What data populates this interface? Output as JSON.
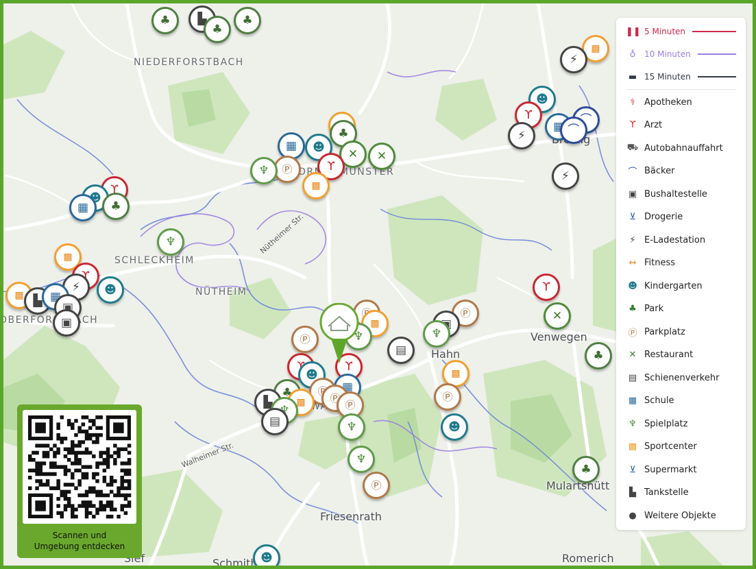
{
  "places": {
    "niederforstbach": "NIEDERFORSTBACH",
    "kornelimuenster": "KORNELIMÜNSTER",
    "schleckheim": "SCHLECKHEIM",
    "nuetheim": "NÜTHEIM",
    "oberforstbach": "OBERFORSTBACH",
    "walheim": "WALHEIM",
    "breinig": "Breinig",
    "hahn": "Hahn",
    "venwegen": "Venwegen",
    "mulartshuette": "Mulartshütt",
    "friesenrath": "Friesenrath",
    "schmithof": "Schmithof",
    "romerich": "Romerich",
    "sief": "Sief"
  },
  "streets": {
    "nuetheimer": "Nütheimer Str.",
    "walheimer": "Walheimer Str."
  },
  "legend": {
    "isochrones": [
      {
        "label": "5 Minuten",
        "icon": "footprints-icon",
        "color": "#d0284b"
      },
      {
        "label": "10 Minuten",
        "icon": "bicycle-icon",
        "color": "#9b7fe0"
      },
      {
        "label": "15 Minuten",
        "icon": "car-icon",
        "color": "#333a44"
      }
    ],
    "categories": [
      {
        "label": "Apotheken",
        "icon": "pharmacy-icon",
        "glyph": "⚕",
        "color": "#d32f2f"
      },
      {
        "label": "Arzt",
        "icon": "stethoscope-icon",
        "glyph": "ϒ",
        "color": "#d32f2f"
      },
      {
        "label": "Autobahnauffahrt",
        "icon": "highway-icon",
        "glyph": "⛟",
        "color": "#555555"
      },
      {
        "label": "Bäcker",
        "icon": "bread-icon",
        "glyph": "⌒",
        "color": "#2b4b9a"
      },
      {
        "label": "Bushaltestelle",
        "icon": "bus-icon",
        "glyph": "▣",
        "color": "#444444"
      },
      {
        "label": "Drogerie",
        "icon": "cart-icon",
        "glyph": "⊻",
        "color": "#1e5aa8"
      },
      {
        "label": "E-Ladestation",
        "icon": "ev-charger-icon",
        "glyph": "⚡",
        "color": "#444444"
      },
      {
        "label": "Fitness",
        "icon": "dumbbell-icon",
        "glyph": "↔",
        "color": "#f08a1a"
      },
      {
        "label": "Kindergarten",
        "icon": "kindergarten-icon",
        "glyph": "☻",
        "color": "#1f7a8c"
      },
      {
        "label": "Park",
        "icon": "tree-icon",
        "glyph": "♣",
        "color": "#2e7d32"
      },
      {
        "label": "Parkplatz",
        "icon": "parking-icon",
        "glyph": "Ⓟ",
        "color": "#b07a4a"
      },
      {
        "label": "Restaurant",
        "icon": "cutlery-icon",
        "glyph": "✕",
        "color": "#3e7a2a"
      },
      {
        "label": "Schienenverkehr",
        "icon": "train-icon",
        "glyph": "▤",
        "color": "#444444"
      },
      {
        "label": "Schule",
        "icon": "school-icon",
        "glyph": "▦",
        "color": "#2a6a9a"
      },
      {
        "label": "Spielplatz",
        "icon": "playground-icon",
        "glyph": "♆",
        "color": "#4c8a38"
      },
      {
        "label": "Sportcenter",
        "icon": "sportcenter-icon",
        "glyph": "▩",
        "color": "#f0a030"
      },
      {
        "label": "Supermarkt",
        "icon": "supermarket-icon",
        "glyph": "⊻",
        "color": "#1e5aa8"
      },
      {
        "label": "Tankstelle",
        "icon": "fuel-icon",
        "glyph": "▙",
        "color": "#444444"
      },
      {
        "label": "Weitere Objekte",
        "icon": "map-pin-icon",
        "glyph": "●",
        "color": "#444444"
      }
    ]
  },
  "qr": {
    "caption_line1": "Scannen und",
    "caption_line2": "Umgebung entdecken"
  },
  "colors": {
    "frame": "#5aa62a",
    "walk": "#d0284b",
    "bike": "#9b7fe0",
    "car": "#333a44"
  }
}
